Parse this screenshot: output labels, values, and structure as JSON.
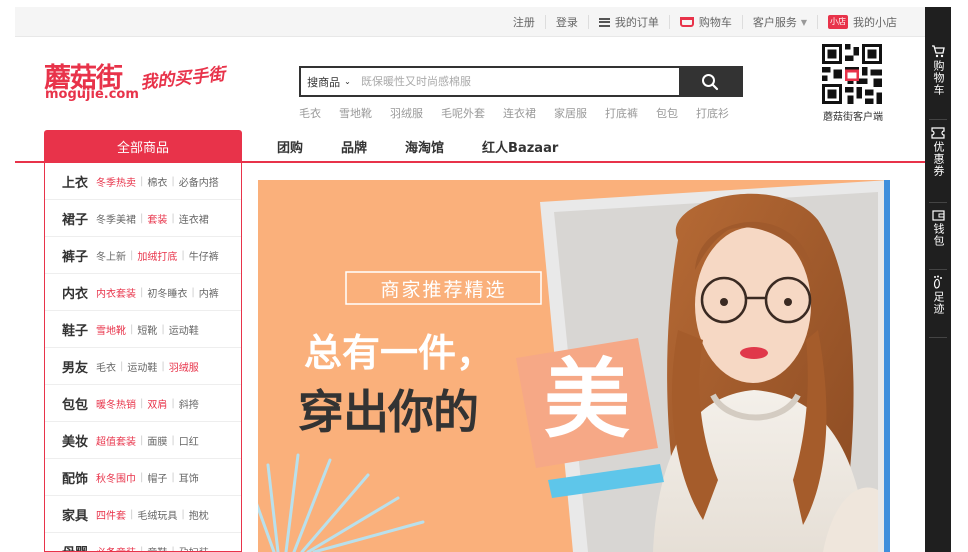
{
  "topbar": {
    "register": "注册",
    "login": "登录",
    "orders": "我的订单",
    "cart": "购物车",
    "service": "客户服务",
    "shop_badge": "小店",
    "shop": "我的小店"
  },
  "logo": {
    "cn": "蘑菇街",
    "en": "mogujie.com",
    "slogan": "我的买手街"
  },
  "search": {
    "category": "搜商品",
    "placeholder": "既保暖性又时尚感棉服",
    "hotwords": [
      "毛衣",
      "雪地靴",
      "羽绒服",
      "毛呢外套",
      "连衣裙",
      "家居服",
      "打底裤",
      "包包",
      "打底衫"
    ]
  },
  "qr": {
    "label": "蘑菇街客户端"
  },
  "nav": {
    "all_categories": "全部商品",
    "links": [
      "团购",
      "品牌",
      "海淘馆",
      "红人Bazaar"
    ]
  },
  "categories": [
    {
      "title": "上衣",
      "subs": [
        {
          "t": "冬季热卖",
          "hot": true
        },
        {
          "t": "棉衣",
          "hot": false
        },
        {
          "t": "必备内搭",
          "hot": false
        }
      ]
    },
    {
      "title": "裙子",
      "subs": [
        {
          "t": "冬季美裙",
          "hot": false
        },
        {
          "t": "套装",
          "hot": true
        },
        {
          "t": "连衣裙",
          "hot": false
        }
      ]
    },
    {
      "title": "裤子",
      "subs": [
        {
          "t": "冬上新",
          "hot": false
        },
        {
          "t": "加绒打底",
          "hot": true
        },
        {
          "t": "牛仔裤",
          "hot": false
        }
      ]
    },
    {
      "title": "内衣",
      "subs": [
        {
          "t": "内衣套装",
          "hot": true
        },
        {
          "t": "初冬睡衣",
          "hot": false
        },
        {
          "t": "内裤",
          "hot": false
        }
      ]
    },
    {
      "title": "鞋子",
      "subs": [
        {
          "t": "雪地靴",
          "hot": true
        },
        {
          "t": "短靴",
          "hot": false
        },
        {
          "t": "运动鞋",
          "hot": false
        }
      ]
    },
    {
      "title": "男友",
      "subs": [
        {
          "t": "毛衣",
          "hot": false
        },
        {
          "t": "运动鞋",
          "hot": false
        },
        {
          "t": "羽绒服",
          "hot": true
        }
      ]
    },
    {
      "title": "包包",
      "subs": [
        {
          "t": "暖冬热销",
          "hot": true
        },
        {
          "t": "双肩",
          "hot": true
        },
        {
          "t": "斜挎",
          "hot": false
        }
      ]
    },
    {
      "title": "美妆",
      "subs": [
        {
          "t": "超值套装",
          "hot": true
        },
        {
          "t": "面膜",
          "hot": false
        },
        {
          "t": "口红",
          "hot": false
        }
      ]
    },
    {
      "title": "配饰",
      "subs": [
        {
          "t": "秋冬围巾",
          "hot": true
        },
        {
          "t": "帽子",
          "hot": false
        },
        {
          "t": "耳饰",
          "hot": false
        }
      ]
    },
    {
      "title": "家具",
      "subs": [
        {
          "t": "四件套",
          "hot": true
        },
        {
          "t": "毛绒玩具",
          "hot": false
        },
        {
          "t": "抱枕",
          "hot": false
        }
      ]
    },
    {
      "title": "母婴",
      "subs": [
        {
          "t": "必备童装",
          "hot": true
        },
        {
          "t": "童鞋",
          "hot": false
        },
        {
          "t": "孕妇装",
          "hot": false
        }
      ]
    }
  ],
  "banner": {
    "box_text": "商家推荐精选",
    "line1": "总有一件，",
    "line2": "穿出你的",
    "highlight": "美"
  },
  "sidebar": [
    {
      "icon": "cart-icon",
      "label": "购物车"
    },
    {
      "icon": "coupon-icon",
      "label": "优惠券"
    },
    {
      "icon": "wallet-icon",
      "label": "钱包"
    },
    {
      "icon": "footprint-icon",
      "label": "足迹"
    }
  ],
  "colors": {
    "brand": "#e8334a",
    "banner_bg": "#fab07b",
    "sidebar_bg": "#1f1f1f",
    "search_button": "#333333"
  }
}
